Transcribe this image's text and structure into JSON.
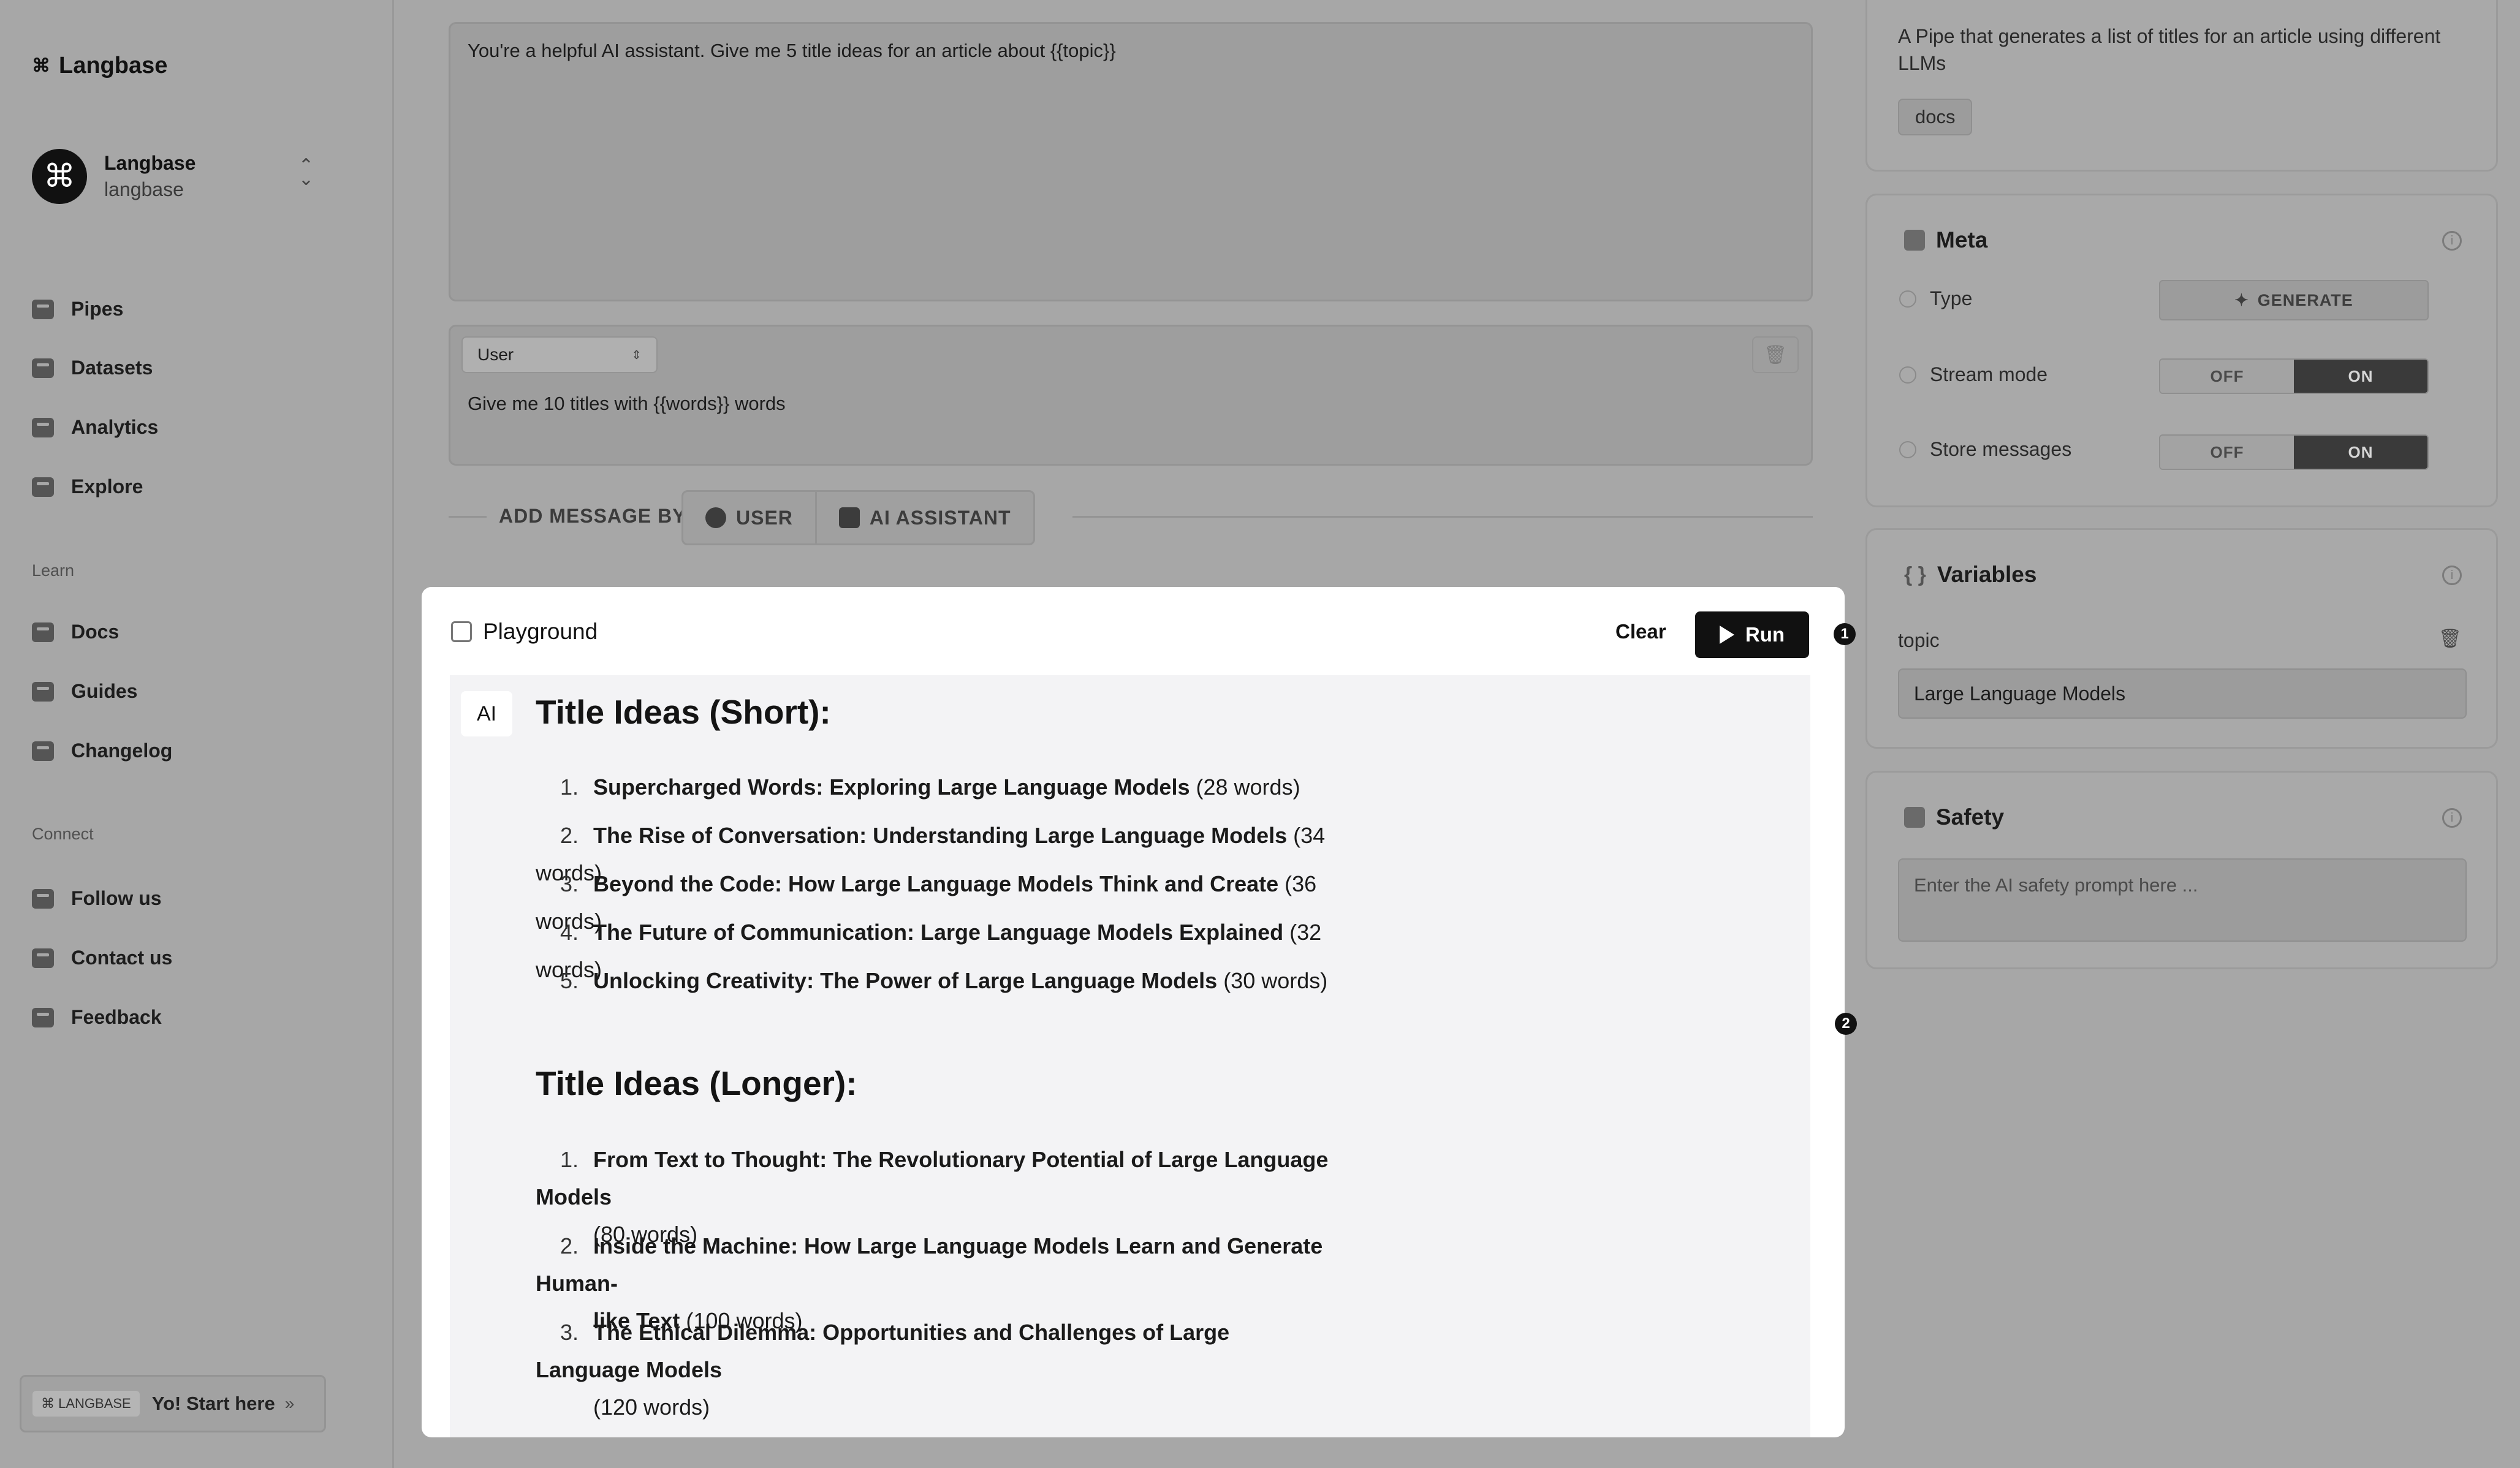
{
  "sidebar": {
    "brand": "Langbase",
    "brand_glyph": "⌘",
    "org_name": "Langbase",
    "org_slug": "langbase",
    "org_switch_icon": "chevron-up-down-icon",
    "nav": [
      "Pipes",
      "Datasets",
      "Analytics",
      "Explore"
    ],
    "learn_label": "Learn",
    "learn": [
      "Docs",
      "Guides",
      "Changelog"
    ],
    "connect_label": "Connect",
    "connect": [
      "Follow us",
      "Contact us",
      "Feedback"
    ],
    "start_brand": "⌘ LANGBASE",
    "start_text": "Yo! Start here",
    "start_arrow": "»"
  },
  "editor": {
    "system_prompt": "You're a helpful AI assistant. Give me 5 title ideas for an article about {{topic}}",
    "message_role": "User",
    "message_text": "Give me 10 titles with {{words}} words",
    "add_message_label": "ADD MESSAGE BY",
    "add_user_label": "USER",
    "add_ai_label": "AI ASSISTANT"
  },
  "right_panel": {
    "about_description": "A Pipe that generates a list of titles for an article using different LLMs",
    "about_tag": "docs",
    "meta_title": "Meta",
    "type_label": "Type",
    "type_value": "GENERATE",
    "stream_label": "Stream mode",
    "store_label": "Store messages",
    "off_label": "OFF",
    "on_label": "ON",
    "stream_mode_on": true,
    "store_messages_on": true,
    "variables_title": "Variables",
    "variable_name": "topic",
    "variable_value": "Large Language Models",
    "safety_title": "Safety",
    "safety_placeholder": "Enter the AI safety prompt here ..."
  },
  "playground": {
    "title": "Playground",
    "clear_label": "Clear",
    "run_label": "Run",
    "callouts": [
      "1",
      "2"
    ],
    "ai_badge": "AI",
    "short_heading": "Title Ideas (Short):",
    "short_items": [
      {
        "num": "1.",
        "title": "Supercharged Words: Exploring Large Language Models",
        "words": "(28 words)"
      },
      {
        "num": "2.",
        "title": "The Rise of Conversation: Understanding Large Language Models",
        "words": "(34 words)"
      },
      {
        "num": "3.",
        "title": "Beyond the Code: How Large Language Models Think and Create",
        "words": "(36 words)"
      },
      {
        "num": "4.",
        "title": "The Future of Communication: Large Language Models Explained",
        "words": "(32 words)"
      },
      {
        "num": "5.",
        "title": "Unlocking Creativity: The Power of Large Language Models",
        "words": "(30 words)"
      }
    ],
    "long_heading": "Title Ideas (Longer):",
    "long_items": [
      {
        "num": "1.",
        "title": "From Text to Thought: The Revolutionary Potential of Large Language Models",
        "words": "(80 words)"
      },
      {
        "num": "2.",
        "title_line1": "Inside the Machine: How Large Language Models Learn and Generate Human-",
        "title_line2": "like Text",
        "words": "(100 words)"
      },
      {
        "num": "3.",
        "title": "The Ethical Dilemma: Opportunities and Challenges of Large Language Models",
        "words": "(120 words)"
      }
    ]
  }
}
